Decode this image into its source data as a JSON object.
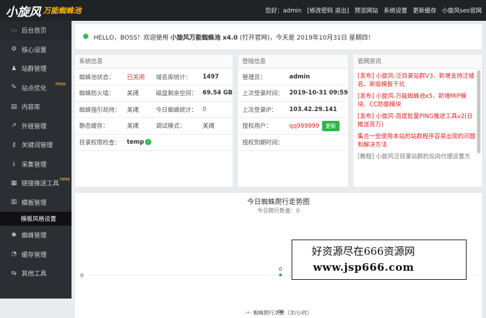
{
  "header": {
    "logo_main": "小旋风",
    "logo_sub": "万能蜘蛛池",
    "greeting": "您好：admin",
    "change_pw": "[修改密码 退出]",
    "preview": "预览网站",
    "settings": "系统设置",
    "refresh_cache": "更新缓存",
    "official": "小旋风seo官网"
  },
  "sidebar": {
    "items": [
      {
        "label": "后台首页",
        "icon": "home-icon"
      },
      {
        "label": "核心设置",
        "icon": "gear-icon"
      },
      {
        "label": "站群管理",
        "icon": "user-icon"
      },
      {
        "label": "站点优化",
        "icon": "leaf-icon",
        "badge": "new"
      },
      {
        "label": "内容库",
        "icon": "book-icon"
      },
      {
        "label": "外链管理",
        "icon": "link-icon"
      },
      {
        "label": "关键词管理",
        "icon": "key-icon"
      },
      {
        "label": "采集管理",
        "icon": "download-icon"
      },
      {
        "label": "链接推送工具",
        "icon": "push-icon",
        "badge": "new"
      },
      {
        "label": "模板管理",
        "icon": "template-icon"
      },
      {
        "label": "蜘蛛管理",
        "icon": "spider-icon"
      },
      {
        "label": "缓存管理",
        "icon": "cache-icon"
      },
      {
        "label": "其他工具",
        "icon": "tools-icon"
      }
    ],
    "sub_item": "模板风格设置"
  },
  "welcome": {
    "prefix": "HELLO，BOSS！欢迎使用",
    "product": "小旋风万能蜘蛛池 x4.0",
    "suffix": "(打开官网)，今天是 2019年10月31日 星期四！"
  },
  "system_info": {
    "title": "系统信息",
    "rows": [
      [
        "蜘蛛池状态：",
        "已关闭",
        "域名库统计：",
        "1497"
      ],
      [
        "蜘蛛防火墙：",
        "关闭",
        "磁盘剩余空间：",
        "69.54 GB"
      ],
      [
        "蜘蛛强引劫持：",
        "关闭",
        "今日蜘蛛统计：",
        "0"
      ],
      [
        "静态缓存：",
        "关闭",
        "调试模式：",
        "关闭"
      ],
      [
        "目录权限检查：",
        "temp",
        "",
        ""
      ]
    ]
  },
  "login_info": {
    "title": "登陆信息",
    "rows": [
      [
        "管理员：",
        "admin"
      ],
      [
        "上次登录时间：",
        "2019-10-31 09:59"
      ],
      [
        "上次登录IP：",
        "103.42.29.141"
      ],
      [
        "授权用户：",
        "qq999999"
      ],
      [
        "授权到期时间：",
        ""
      ]
    ],
    "update_button": "更新"
  },
  "news": {
    "title": "官网资讯",
    "items": [
      "[发布] 小旋风-泛目录站群V3、新增支持泛域名、新版模板千坑",
      "[发布] 小旋风-万能蜘蛛池x5、新增MIP模块、CC防御模块",
      "[发布] 小旋风-百度批量PING推送工具v2(日推送百万)",
      "集合一些使用本站的站群程序容易出现的问题和解决方法",
      "[教程] 小旋风泛目录站群的反向代理设置方"
    ]
  },
  "chart_data": {
    "type": "line",
    "title": "今日蜘蛛爬行走势图",
    "subtitle": "今日爬行数量：0",
    "x": [
      "00"
    ],
    "series": [
      {
        "name": "蜘蛛爬行次数（次/小时）",
        "values": [
          0
        ]
      }
    ],
    "ylabel": "",
    "ytick": "0",
    "point_label": "0",
    "color": "#3a8fc9"
  },
  "watermark": {
    "line1": "好资源尽在666资源网",
    "line2": "www.jsp666.com"
  }
}
